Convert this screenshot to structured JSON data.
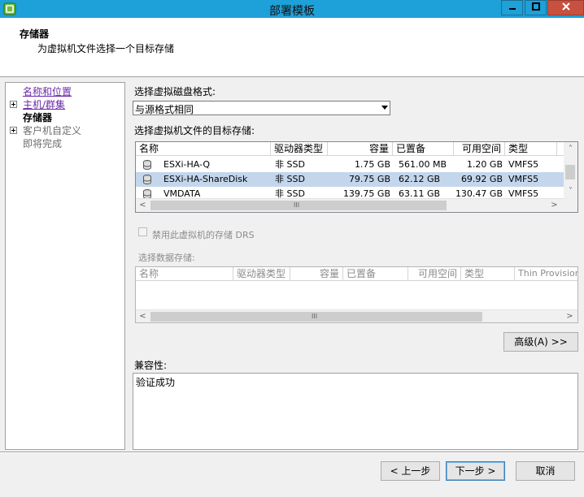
{
  "window": {
    "title": "部署模板"
  },
  "header": {
    "title": "存储器",
    "subtitle": "为虚拟机文件选择一个目标存储"
  },
  "nav": {
    "items": [
      {
        "label": "名称和位置"
      },
      {
        "label": "主机/群集"
      },
      {
        "label": "存储器"
      },
      {
        "label": "客户机自定义"
      },
      {
        "label": "即将完成"
      }
    ]
  },
  "disk_format": {
    "label": "选择虚拟磁盘格式:",
    "value": "与源格式相同"
  },
  "target": {
    "label": "选择虚拟机文件的目标存储:",
    "columns": [
      "名称",
      "驱动器类型",
      "容量",
      "已置备",
      "可用空间",
      "类型"
    ],
    "rows": [
      {
        "name": "ESXi-HA-Q",
        "drive_type": "非 SSD",
        "capacity": "1.75 GB",
        "provisioned": "561.00 MB",
        "free": "1.20 GB",
        "type": "VMFS5"
      },
      {
        "name": "ESXi-HA-ShareDisk",
        "drive_type": "非 SSD",
        "capacity": "79.75 GB",
        "provisioned": "62.12 GB",
        "free": "69.92 GB",
        "type": "VMFS5"
      },
      {
        "name": "VMDATA",
        "drive_type": "非 SSD",
        "capacity": "139.75 GB",
        "provisioned": "63.11 GB",
        "free": "130.47 GB",
        "type": "VMFS5"
      }
    ],
    "selected_index": 1
  },
  "drs": {
    "label": "禁用此虚拟机的存储 DRS"
  },
  "datastore": {
    "label": "选择数据存储:",
    "columns": [
      "名称",
      "驱动器类型",
      "容量",
      "已置备",
      "可用空间",
      "类型",
      "Thin Provisioning"
    ]
  },
  "advanced_button": "高级(A) >>",
  "compatibility": {
    "label": "兼容性:",
    "value": "验证成功"
  },
  "footer": {
    "back": "< 上一步",
    "next": "下一步 >",
    "cancel": "取消"
  },
  "scroll_grip": "III",
  "colors": {
    "titlebar": "#1ea0d8",
    "selection": "#c4d6ec",
    "close": "#c7503f",
    "link": "#6b2aa8"
  }
}
